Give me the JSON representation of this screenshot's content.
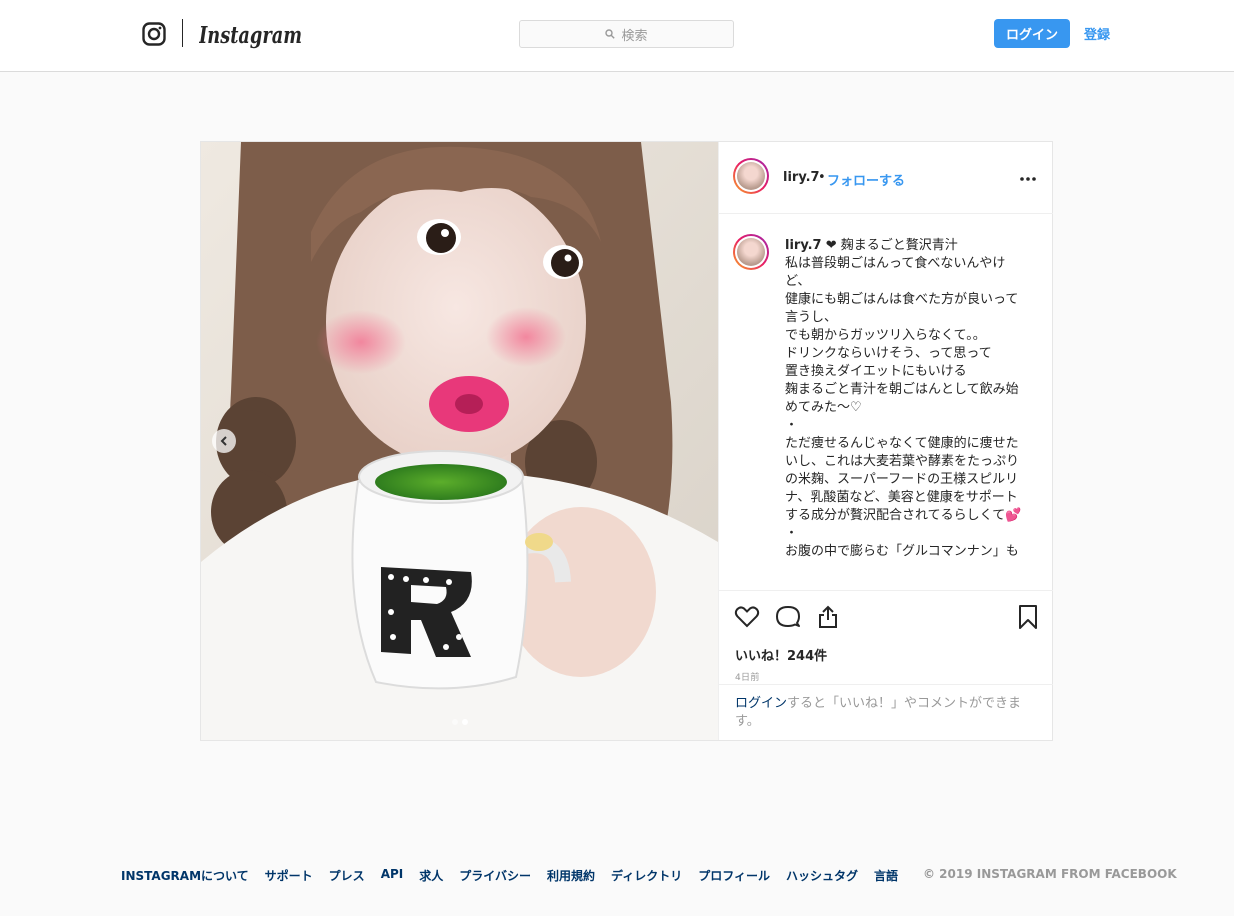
{
  "header": {
    "search_placeholder": "検索",
    "login_label": "ログイン",
    "signup_label": "登録"
  },
  "post": {
    "username": "liry.7",
    "separator": "•",
    "follow_label": "フォローする",
    "caption_user": "liry.7",
    "caption_text": " ❤ 麹まるごと贅沢青汁\n私は普段朝ごはんって食べないんやけど、\n健康にも朝ごはんは食べた方が良いって言うし、\nでも朝からガッツリ入らなくて。。\nドリンクならいけそう、って思って\n置き換えダイエットにもいける\n麹まるごと青汁を朝ごはんとして飲み始めてみた〜♡\n・\nただ痩せるんじゃなくて健康的に痩せたいし、これは大麦若葉や酵素をたっぷりの米麹、スーパーフードの王様スピルリナ、乳酸菌など、美容と健康をサポートする成分が贅沢配合されてるらしくて💕\n・\nお腹の中で膨らむ「グルコマンナン」も",
    "likes": "いいね！244件",
    "timestamp": "4日前",
    "login_prompt_link": "ログイン",
    "login_prompt_rest": "すると「いいね！」やコメントができます。",
    "carousel_total": 2,
    "carousel_active": 2
  },
  "icons": {
    "logo": "instagram-glyph-icon",
    "search": "search-icon",
    "more": "more-options-icon",
    "prev": "chevron-left-icon",
    "like": "heart-icon",
    "comment": "comment-icon",
    "share": "share-icon",
    "save": "bookmark-icon"
  },
  "footer": {
    "links": [
      "INSTAGRAMについて",
      "サポート",
      "プレス",
      "API",
      "求人",
      "プライバシー",
      "利用規約",
      "ディレクトリ",
      "プロフィール",
      "ハッシュタグ",
      "言語"
    ],
    "copyright": "© 2019 INSTAGRAM FROM FACEBOOK"
  },
  "colors": {
    "accent": "#3897f0",
    "link_dark": "#003569",
    "border": "#dbdbdb",
    "bg": "#fafafa"
  }
}
